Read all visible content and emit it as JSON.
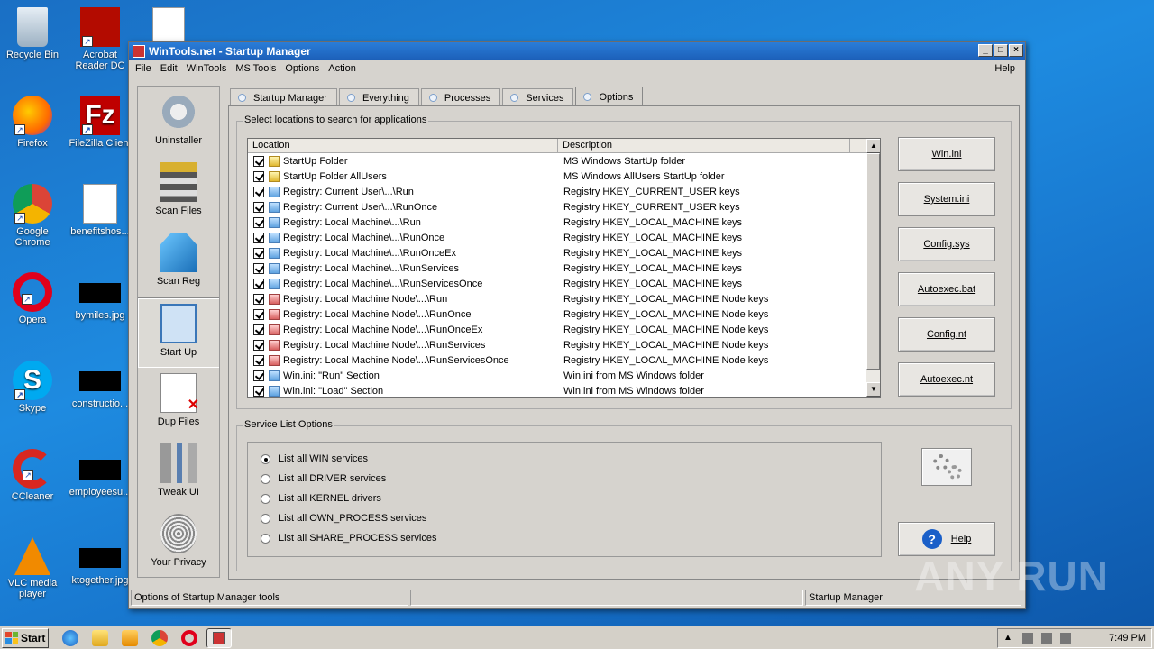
{
  "desktop": {
    "icons": [
      {
        "label": "Recycle Bin"
      },
      {
        "label": "Acrobat Reader DC"
      },
      {
        "label": "Firefox"
      },
      {
        "label": "FileZilla Client"
      },
      {
        "label": "Google Chrome"
      },
      {
        "label": "benefitshos..."
      },
      {
        "label": "Opera"
      },
      {
        "label": "bymiles.jpg"
      },
      {
        "label": "Skype"
      },
      {
        "label": "constructio..."
      },
      {
        "label": "CCleaner"
      },
      {
        "label": "employeesu..."
      },
      {
        "label": "VLC media player"
      },
      {
        "label": "ktogether.jpg"
      }
    ]
  },
  "window": {
    "title": "WinTools.net - Startup Manager",
    "menu": [
      "File",
      "Edit",
      "WinTools",
      "MS Tools",
      "Options",
      "Action"
    ],
    "help": "Help"
  },
  "tools": [
    "Uninstaller",
    "Scan Files",
    "Scan Reg",
    "Start Up",
    "Dup Files",
    "Tweak UI",
    "Your Privacy"
  ],
  "tabs": [
    "Startup Manager",
    "Everything",
    "Processes",
    "Services",
    "Options"
  ],
  "locations": {
    "legend": "Select locations to search for applications",
    "headers": [
      "Location",
      "Description"
    ],
    "rows": [
      {
        "loc": "StartUp Folder",
        "desc": "MS Windows StartUp folder",
        "checked": true
      },
      {
        "loc": "StartUp Folder AllUsers",
        "desc": "MS Windows AllUsers StartUp folder",
        "checked": true
      },
      {
        "loc": "Registry: Current User\\...\\Run",
        "desc": "Registry HKEY_CURRENT_USER keys",
        "checked": true
      },
      {
        "loc": "Registry: Current User\\...\\RunOnce",
        "desc": "Registry HKEY_CURRENT_USER keys",
        "checked": true
      },
      {
        "loc": "Registry: Local Machine\\...\\Run",
        "desc": "Registry HKEY_LOCAL_MACHINE keys",
        "checked": true
      },
      {
        "loc": "Registry: Local Machine\\...\\RunOnce",
        "desc": "Registry HKEY_LOCAL_MACHINE keys",
        "checked": true
      },
      {
        "loc": "Registry: Local Machine\\...\\RunOnceEx",
        "desc": "Registry HKEY_LOCAL_MACHINE keys",
        "checked": true
      },
      {
        "loc": "Registry: Local Machine\\...\\RunServices",
        "desc": "Registry HKEY_LOCAL_MACHINE keys",
        "checked": true
      },
      {
        "loc": "Registry: Local Machine\\...\\RunServicesOnce",
        "desc": "Registry HKEY_LOCAL_MACHINE keys",
        "checked": true
      },
      {
        "loc": "Registry: Local Machine Node\\...\\Run",
        "desc": "Registry HKEY_LOCAL_MACHINE Node keys",
        "checked": true
      },
      {
        "loc": "Registry: Local Machine Node\\...\\RunOnce",
        "desc": "Registry HKEY_LOCAL_MACHINE Node keys",
        "checked": true
      },
      {
        "loc": "Registry: Local Machine Node\\...\\RunOnceEx",
        "desc": "Registry HKEY_LOCAL_MACHINE Node keys",
        "checked": true
      },
      {
        "loc": "Registry: Local Machine Node\\...\\RunServices",
        "desc": "Registry HKEY_LOCAL_MACHINE Node keys",
        "checked": true
      },
      {
        "loc": "Registry: Local Machine Node\\...\\RunServicesOnce",
        "desc": "Registry HKEY_LOCAL_MACHINE Node keys",
        "checked": true
      },
      {
        "loc": "Win.ini: \"Run\" Section",
        "desc": "Win.ini from MS Windows folder",
        "checked": true
      },
      {
        "loc": "Win.ini: \"Load\" Section",
        "desc": "Win.ini from MS Windows folder",
        "checked": true
      }
    ],
    "buttons": [
      "Win.ini",
      "System.ini",
      "Config.sys",
      "Autoexec.bat",
      "Config.nt",
      "Autoexec.nt"
    ]
  },
  "service_options": {
    "legend": "Service List Options",
    "options": [
      {
        "label": "List all WIN services",
        "selected": true
      },
      {
        "label": "List all DRIVER services",
        "selected": false
      },
      {
        "label": "List all KERNEL drivers",
        "selected": false
      },
      {
        "label": "List all OWN_PROCESS services",
        "selected": false
      },
      {
        "label": "List all SHARE_PROCESS services",
        "selected": false
      }
    ],
    "help_label": "Help"
  },
  "status": {
    "left": "Options of Startup Manager tools",
    "middle": "",
    "right": "Startup Manager"
  },
  "taskbar": {
    "start": "Start",
    "clock": "7:49 PM"
  },
  "watermark": "ANY RUN"
}
